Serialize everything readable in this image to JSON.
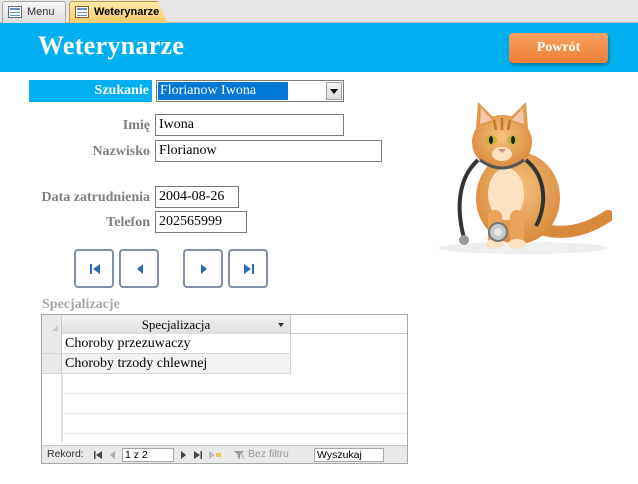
{
  "tabs": [
    {
      "label": "Menu",
      "active": false
    },
    {
      "label": "Weterynarze",
      "active": true
    }
  ],
  "header": {
    "title": "Weterynarze",
    "back_button": "Powrót",
    "color": "#00b0f0",
    "button_color": "#ed7d31"
  },
  "search": {
    "label": "Szukanie",
    "value": "Florianow Iwona"
  },
  "fields": {
    "first_name_label": "Imię",
    "first_name": "Iwona",
    "last_name_label": "Nazwisko",
    "last_name": "Florianow",
    "hire_date_label": "Data zatrudnienia",
    "hire_date": "2004-08-26",
    "phone_label": "Telefon",
    "phone": "202565999"
  },
  "record_nav_buttons": [
    "first-record-icon",
    "previous-record-icon",
    "next-record-icon",
    "last-record-icon"
  ],
  "subform": {
    "label": "Specjalizacje",
    "column_header": "Specjalizacja",
    "rows": [
      "Choroby przezuwaczy",
      "Choroby trzody chlewnej"
    ],
    "navbar": {
      "record_label": "Rekord:",
      "position": "1 z 2",
      "filter_label": "Bez filtru",
      "search_placeholder": "Wyszukaj"
    }
  }
}
